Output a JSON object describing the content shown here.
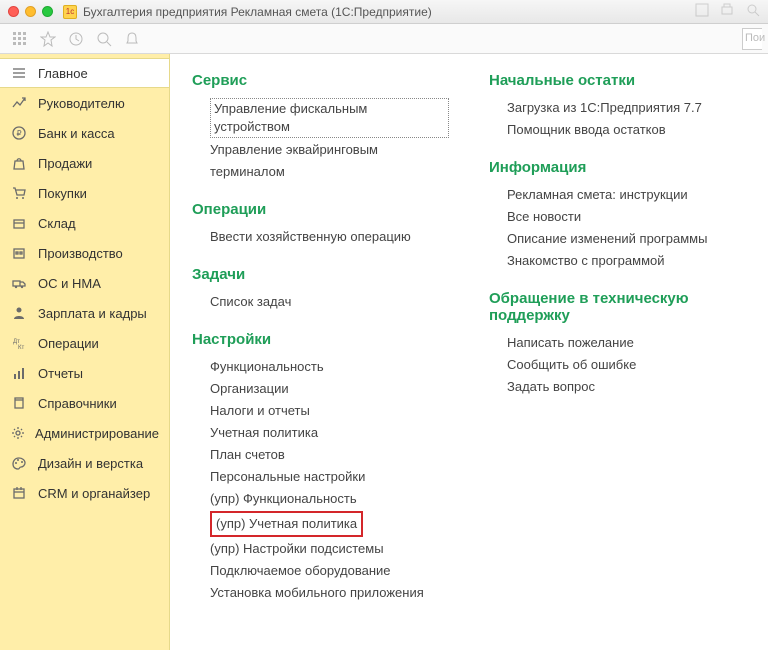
{
  "window": {
    "title": "Бухгалтерия предприятия Рекламная смета  (1С:Предприятие)",
    "app_icon_text": "1c"
  },
  "search": {
    "placeholder": "Пои"
  },
  "sidebar": {
    "items": [
      {
        "label": "Главное",
        "icon": "menu-icon"
      },
      {
        "label": "Руководителю",
        "icon": "chart-icon"
      },
      {
        "label": "Банк и касса",
        "icon": "ruble-icon"
      },
      {
        "label": "Продажи",
        "icon": "bag-icon"
      },
      {
        "label": "Покупки",
        "icon": "cart-icon"
      },
      {
        "label": "Склад",
        "icon": "box-icon"
      },
      {
        "label": "Производство",
        "icon": "factory-icon"
      },
      {
        "label": "ОС и НМА",
        "icon": "truck-icon"
      },
      {
        "label": "Зарплата и кадры",
        "icon": "person-icon"
      },
      {
        "label": "Операции",
        "icon": "dtkt-icon"
      },
      {
        "label": "Отчеты",
        "icon": "bars-icon"
      },
      {
        "label": "Справочники",
        "icon": "book-icon"
      },
      {
        "label": "Администрирование",
        "icon": "gear-icon"
      },
      {
        "label": "Дизайн и верстка",
        "icon": "palette-icon"
      },
      {
        "label": "CRM и органайзер",
        "icon": "calendar-icon"
      }
    ]
  },
  "content": {
    "left": [
      {
        "title": "Сервис",
        "links": [
          {
            "label": "Управление фискальным устройством",
            "selected": true
          },
          {
            "label": "Управление эквайринговым терминалом"
          }
        ]
      },
      {
        "title": "Операции",
        "links": [
          {
            "label": "Ввести хозяйственную операцию"
          }
        ]
      },
      {
        "title": "Задачи",
        "links": [
          {
            "label": "Список задач"
          }
        ]
      },
      {
        "title": "Настройки",
        "links": [
          {
            "label": "Функциональность"
          },
          {
            "label": "Организации"
          },
          {
            "label": "Налоги и отчеты"
          },
          {
            "label": "Учетная политика"
          },
          {
            "label": "План счетов"
          },
          {
            "label": "Персональные настройки"
          },
          {
            "label": "(упр) Функциональность"
          },
          {
            "label": "(упр) Учетная политика",
            "highlight": true
          },
          {
            "label": "(упр) Настройки подсистемы"
          },
          {
            "label": "Подключаемое оборудование"
          },
          {
            "label": "Установка мобильного приложения"
          }
        ]
      }
    ],
    "right": [
      {
        "title": "Начальные остатки",
        "links": [
          {
            "label": "Загрузка из 1С:Предприятия 7.7"
          },
          {
            "label": "Помощник ввода остатков"
          }
        ]
      },
      {
        "title": "Информация",
        "links": [
          {
            "label": "Рекламная смета: инструкции"
          },
          {
            "label": "Все новости"
          },
          {
            "label": "Описание изменений программы"
          },
          {
            "label": "Знакомство с программой"
          }
        ]
      },
      {
        "title": "Обращение в техническую поддержку",
        "links": [
          {
            "label": "Написать пожелание"
          },
          {
            "label": "Сообщить об ошибке"
          },
          {
            "label": "Задать вопрос"
          }
        ]
      }
    ]
  }
}
